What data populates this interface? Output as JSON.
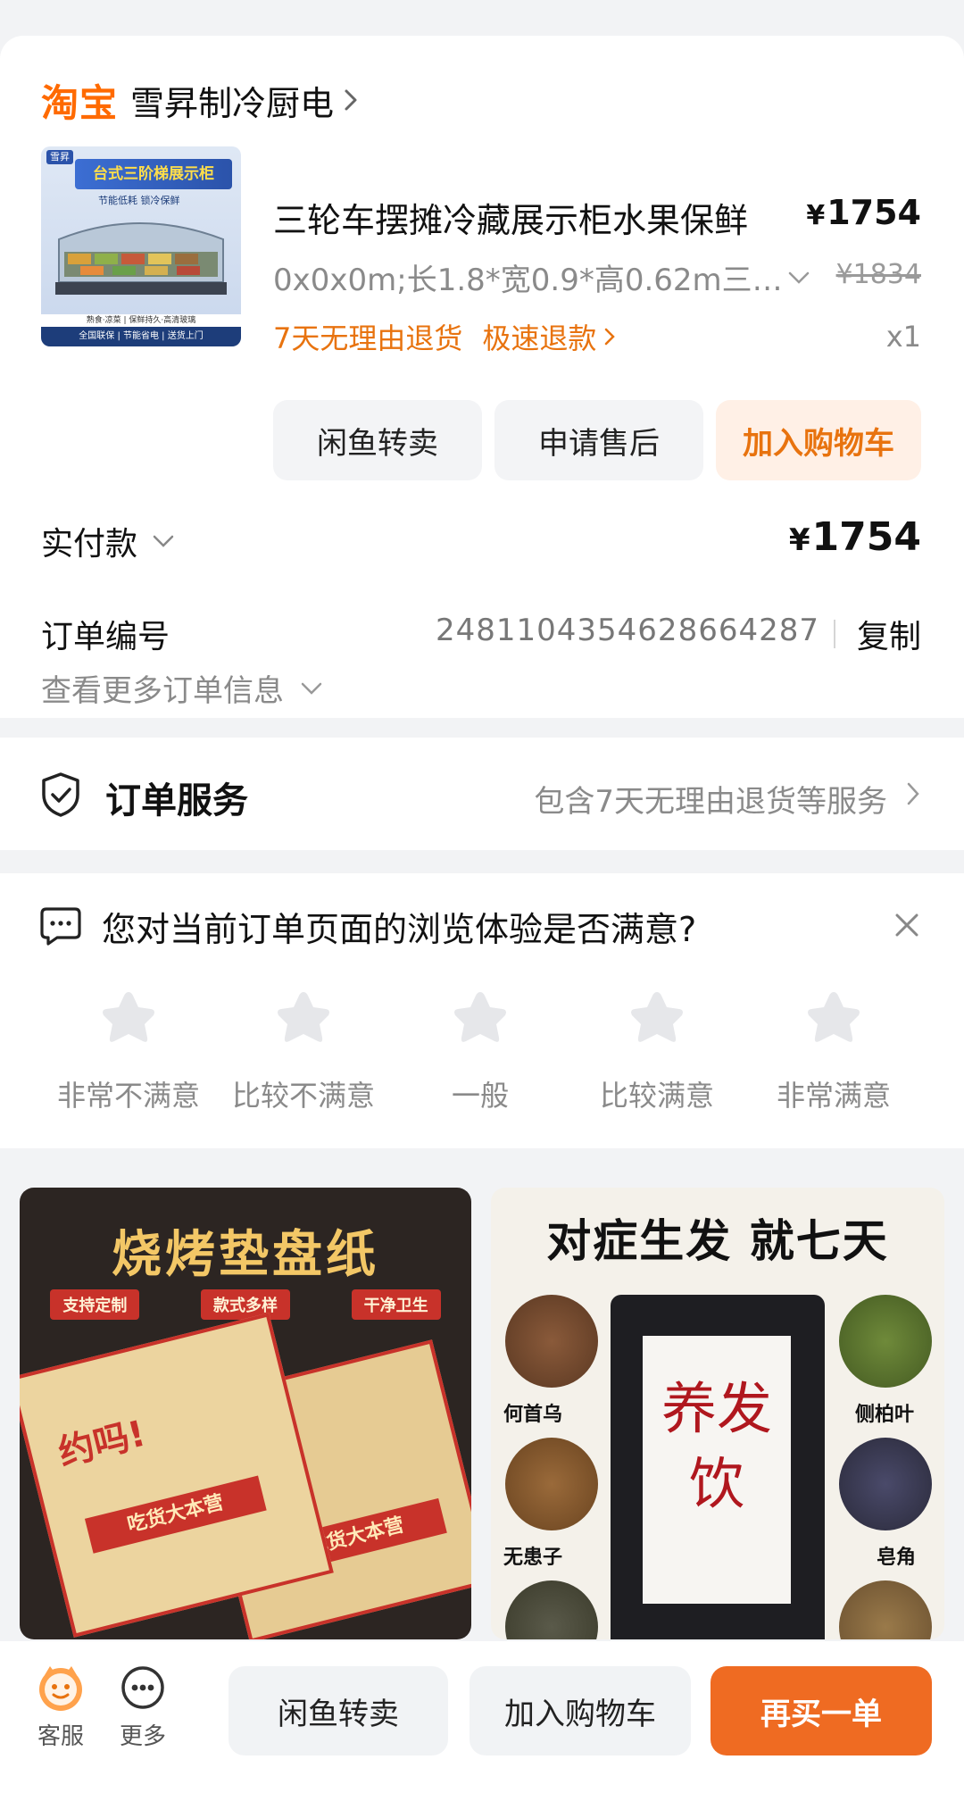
{
  "order": {
    "shop_logo": "淘宝",
    "shop_name": "雪昇制冷厨电",
    "product": {
      "thumb_banner": "台式三阶梯展示柜",
      "thumb_sub": "节能低耗 锁冷保鲜",
      "thumb_logo": "雪昇",
      "thumb_footer": "全国联保 | 节能省电 | 送货上门",
      "thumb_footer2": "熟食·凉菜 | 保鲜持久·高清玻璃",
      "title": "三轮车摆摊冷藏展示柜水果保鲜",
      "price": "1754",
      "currency": "¥",
      "sku": "0x0x0m;长1.8*宽0.9*高0.62m三…",
      "original_price": "¥1834",
      "tag1": "7天无理由退货",
      "tag2": "极速退款",
      "qty": "x1"
    },
    "buttons": {
      "resell": "闲鱼转卖",
      "after_sale": "申请售后",
      "add_cart": "加入购物车"
    },
    "paid_label": "实付款",
    "paid_amount": "1754",
    "order_no_label": "订单编号",
    "order_no": "2481104354628664287",
    "copy_label": "复制",
    "more_info": "查看更多订单信息"
  },
  "service": {
    "title": "订单服务",
    "desc": "包含7天无理由退货等服务"
  },
  "survey": {
    "question": "您对当前订单页面的浏览体验是否满意?",
    "ratings": [
      "非常不满意",
      "比较不满意",
      "一般",
      "比较满意",
      "非常满意"
    ]
  },
  "recommendations": {
    "left": {
      "title": "烧烤垫盘纸",
      "tags": [
        "支持定制",
        "款式多样",
        "干净卫生"
      ],
      "mat_text": "约吗!",
      "mat_bar": "吃货大本营"
    },
    "right": {
      "title": "对症生发 就七天",
      "label": "养发饮",
      "herbs": [
        "何首乌",
        "侧柏叶",
        "无患子",
        "皂角"
      ]
    }
  },
  "bottom_bar": {
    "service_label": "客服",
    "more_label": "更多",
    "resell": "闲鱼转卖",
    "add_cart": "加入购物车",
    "rebuy": "再买一单"
  },
  "colors": {
    "accent_orange": "#ef6b22",
    "tag_orange": "#e8730f",
    "taobao_orange": "#ff6a00"
  }
}
